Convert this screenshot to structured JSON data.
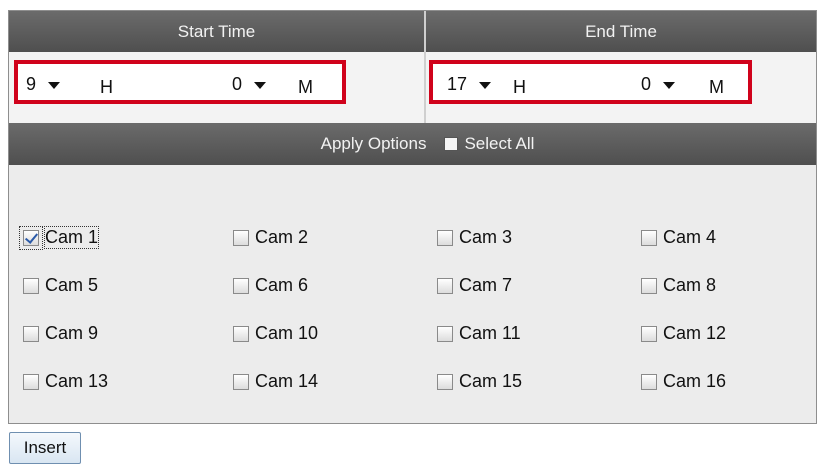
{
  "time_header": {
    "start_label": "Start Time",
    "end_label": "End Time"
  },
  "start_time": {
    "hour_value": "9",
    "hour_unit": "H",
    "minute_value": "0",
    "minute_unit": "M"
  },
  "end_time": {
    "hour_value": "17",
    "hour_unit": "H",
    "minute_value": "0",
    "minute_unit": "M"
  },
  "apply_options": {
    "label": "Apply Options",
    "select_all_label": "Select All",
    "select_all_checked": false
  },
  "cameras": [
    {
      "label": "Cam 1",
      "checked": true
    },
    {
      "label": "Cam 2",
      "checked": false
    },
    {
      "label": "Cam 3",
      "checked": false
    },
    {
      "label": "Cam 4",
      "checked": false
    },
    {
      "label": "Cam 5",
      "checked": false
    },
    {
      "label": "Cam 6",
      "checked": false
    },
    {
      "label": "Cam 7",
      "checked": false
    },
    {
      "label": "Cam 8",
      "checked": false
    },
    {
      "label": "Cam 9",
      "checked": false
    },
    {
      "label": "Cam 10",
      "checked": false
    },
    {
      "label": "Cam 11",
      "checked": false
    },
    {
      "label": "Cam 12",
      "checked": false
    },
    {
      "label": "Cam 13",
      "checked": false
    },
    {
      "label": "Cam 14",
      "checked": false
    },
    {
      "label": "Cam 15",
      "checked": false
    },
    {
      "label": "Cam 16",
      "checked": false
    }
  ],
  "actions": {
    "insert_label": "Insert"
  },
  "colors": {
    "highlight_border": "#d0021b",
    "header_bg": "#5a5a5a",
    "checkmark": "#2b5aa8"
  }
}
